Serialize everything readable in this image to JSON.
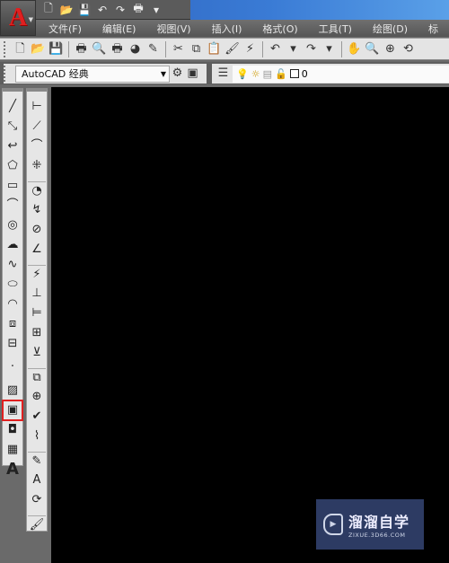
{
  "app": {
    "logo_letter": "A"
  },
  "quick_access": [
    "new-icon",
    "open-icon",
    "save-icon",
    "undo-icon",
    "redo-icon",
    "plot-icon",
    "dropdown-icon"
  ],
  "quick_glyphs": [
    "🗋",
    "📂",
    "💾",
    "↶",
    "↷",
    "🖶",
    "▾"
  ],
  "menus": [
    "文件(F)",
    "编辑(E)",
    "视图(V)",
    "插入(I)",
    "格式(O)",
    "工具(T)",
    "绘图(D)",
    "标"
  ],
  "standard_toolbar": {
    "names": [
      "new-icon",
      "open-icon",
      "save-icon",
      "|",
      "plot-icon",
      "plot-preview-icon",
      "publish-icon",
      "3d-dwf-icon",
      "sheet-set-icon",
      "|",
      "cut-icon",
      "copy-icon",
      "paste-icon",
      "match-properties-icon",
      "block-editor-icon",
      "|",
      "undo-icon",
      "undo-dropdown-icon",
      "redo-icon",
      "redo-dropdown-icon",
      "|",
      "pan-icon",
      "zoom-realtime-icon",
      "zoom-window-icon",
      "zoom-previous-icon"
    ],
    "glyphs": [
      "🗋",
      "📂",
      "💾",
      "|",
      "🖶",
      "🔍",
      "🖶",
      "◕",
      "✎",
      "|",
      "✂",
      "⧉",
      "📋",
      "🖌",
      "⚡",
      "|",
      "↶",
      "▾",
      "↷",
      "▾",
      "|",
      "✋",
      "🔍",
      "⊕",
      "⟲"
    ]
  },
  "workspace": {
    "value": "AutoCAD 经典"
  },
  "layer": {
    "current": "0"
  },
  "draw_toolbar": {
    "names": [
      "line-icon",
      "construction-line-icon",
      "polyline-icon",
      "polygon-icon",
      "rectangle-icon",
      "arc-icon",
      "circle-icon",
      "revision-cloud-icon",
      "spline-icon",
      "ellipse-icon",
      "ellipse-arc-icon",
      "insert-block-icon",
      "make-block-icon",
      "point-icon",
      "hatch-icon",
      "gradient-icon",
      "region-icon",
      "table-icon",
      "multiline-text-icon"
    ],
    "glyphs": [
      "╱",
      "⤡",
      "↩",
      "⬠",
      "▭",
      "⌒",
      "◎",
      "☁",
      "∿",
      "⬭",
      "◠",
      "⧈",
      "⊟",
      "·",
      "▨",
      "▣",
      "◘",
      "▦",
      "A"
    ]
  },
  "dimension_toolbar": {
    "names": [
      "linear-dim-icon",
      "aligned-dim-icon",
      "arc-length-icon",
      "ordinate-icon",
      "radius-icon",
      "jogged-icon",
      "diameter-icon",
      "angular-icon",
      "quick-dim-icon",
      "baseline-icon",
      "continue-icon",
      "dim-space-icon",
      "dim-break-icon",
      "tolerance-icon",
      "center-mark-icon",
      "inspection-icon",
      "jogged-linear-icon",
      "dim-edit-icon",
      "dim-text-edit-icon",
      "dim-update-icon",
      "dim-style-icon"
    ],
    "glyphs": [
      "⊢",
      "⟋",
      "⌒",
      "⁜",
      "◔",
      "↯",
      "⊘",
      "∠",
      "⚡",
      "⊥",
      "⊨",
      "⊞",
      "⊻",
      "⧉",
      "⊕",
      "✔",
      "⌇",
      "✎",
      "A",
      "⟳",
      "🖌"
    ],
    "groups_start": [
      4,
      8,
      13,
      17,
      20
    ]
  },
  "highlighted_tool": "gradient-icon",
  "highlight_color": "#e02020",
  "watermark": {
    "title": "溜溜自学",
    "subtitle": "ZIXUE.3D66.COM"
  }
}
